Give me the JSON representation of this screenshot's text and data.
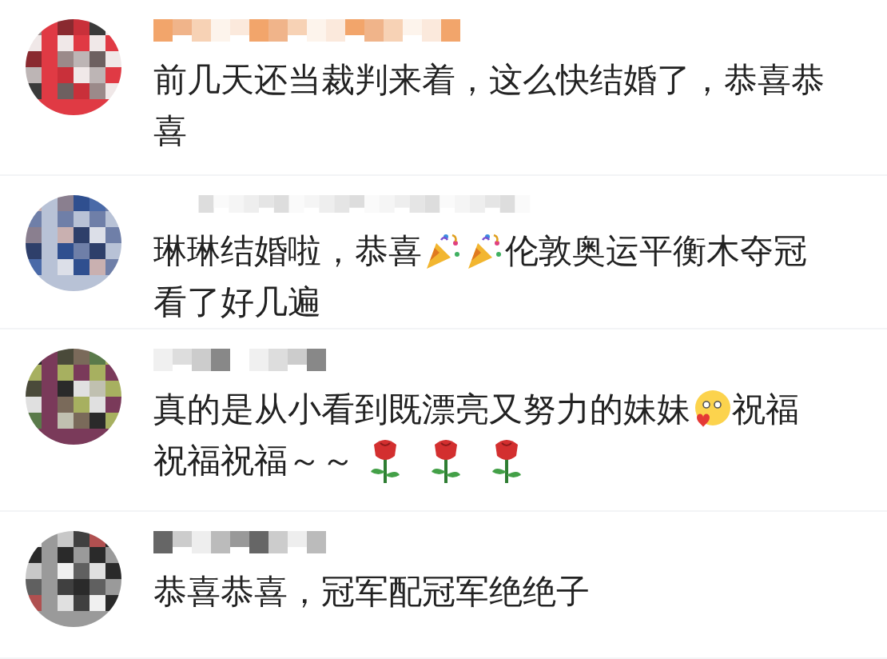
{
  "comments": [
    {
      "lines": [
        [
          {
            "kind": "text",
            "text": "前几天还当裁判来着，这么快结婚了，恭喜恭"
          }
        ],
        [
          {
            "kind": "text",
            "text": "喜"
          }
        ]
      ]
    },
    {
      "lines": [
        [
          {
            "kind": "text",
            "text": "琳琳结婚啦，恭喜"
          },
          {
            "kind": "party"
          },
          {
            "kind": "party"
          },
          {
            "kind": "text",
            "text": "伦敦奥运平衡木夺冠"
          }
        ],
        [
          {
            "kind": "text",
            "text": "看了好几遍"
          }
        ]
      ]
    },
    {
      "lines": [
        [
          {
            "kind": "text",
            "text": "真的是从小看到既漂亮又努力的妹妹"
          },
          {
            "kind": "blush"
          },
          {
            "kind": "text",
            "text": "祝福"
          }
        ],
        [
          {
            "kind": "text",
            "text": "祝福祝福～～"
          },
          {
            "kind": "rose"
          },
          {
            "kind": "rose"
          },
          {
            "kind": "rose"
          }
        ]
      ]
    },
    {
      "lines": [
        [
          {
            "kind": "text",
            "text": "恭喜恭喜，冠军配冠军绝绝子"
          }
        ]
      ]
    }
  ]
}
